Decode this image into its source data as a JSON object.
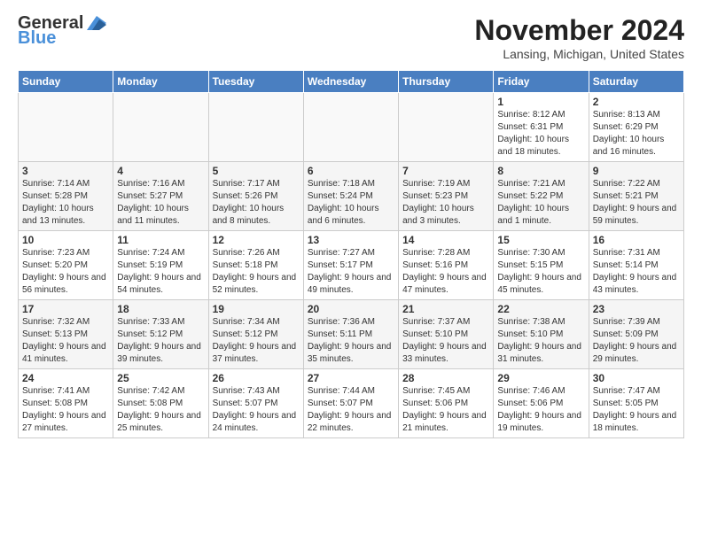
{
  "header": {
    "logo_general": "General",
    "logo_blue": "Blue",
    "month_title": "November 2024",
    "location": "Lansing, Michigan, United States"
  },
  "weekdays": [
    "Sunday",
    "Monday",
    "Tuesday",
    "Wednesday",
    "Thursday",
    "Friday",
    "Saturday"
  ],
  "weeks": [
    [
      {
        "day": "",
        "info": ""
      },
      {
        "day": "",
        "info": ""
      },
      {
        "day": "",
        "info": ""
      },
      {
        "day": "",
        "info": ""
      },
      {
        "day": "",
        "info": ""
      },
      {
        "day": "1",
        "info": "Sunrise: 8:12 AM\nSunset: 6:31 PM\nDaylight: 10 hours and 18 minutes."
      },
      {
        "day": "2",
        "info": "Sunrise: 8:13 AM\nSunset: 6:29 PM\nDaylight: 10 hours and 16 minutes."
      }
    ],
    [
      {
        "day": "3",
        "info": "Sunrise: 7:14 AM\nSunset: 5:28 PM\nDaylight: 10 hours and 13 minutes."
      },
      {
        "day": "4",
        "info": "Sunrise: 7:16 AM\nSunset: 5:27 PM\nDaylight: 10 hours and 11 minutes."
      },
      {
        "day": "5",
        "info": "Sunrise: 7:17 AM\nSunset: 5:26 PM\nDaylight: 10 hours and 8 minutes."
      },
      {
        "day": "6",
        "info": "Sunrise: 7:18 AM\nSunset: 5:24 PM\nDaylight: 10 hours and 6 minutes."
      },
      {
        "day": "7",
        "info": "Sunrise: 7:19 AM\nSunset: 5:23 PM\nDaylight: 10 hours and 3 minutes."
      },
      {
        "day": "8",
        "info": "Sunrise: 7:21 AM\nSunset: 5:22 PM\nDaylight: 10 hours and 1 minute."
      },
      {
        "day": "9",
        "info": "Sunrise: 7:22 AM\nSunset: 5:21 PM\nDaylight: 9 hours and 59 minutes."
      }
    ],
    [
      {
        "day": "10",
        "info": "Sunrise: 7:23 AM\nSunset: 5:20 PM\nDaylight: 9 hours and 56 minutes."
      },
      {
        "day": "11",
        "info": "Sunrise: 7:24 AM\nSunset: 5:19 PM\nDaylight: 9 hours and 54 minutes."
      },
      {
        "day": "12",
        "info": "Sunrise: 7:26 AM\nSunset: 5:18 PM\nDaylight: 9 hours and 52 minutes."
      },
      {
        "day": "13",
        "info": "Sunrise: 7:27 AM\nSunset: 5:17 PM\nDaylight: 9 hours and 49 minutes."
      },
      {
        "day": "14",
        "info": "Sunrise: 7:28 AM\nSunset: 5:16 PM\nDaylight: 9 hours and 47 minutes."
      },
      {
        "day": "15",
        "info": "Sunrise: 7:30 AM\nSunset: 5:15 PM\nDaylight: 9 hours and 45 minutes."
      },
      {
        "day": "16",
        "info": "Sunrise: 7:31 AM\nSunset: 5:14 PM\nDaylight: 9 hours and 43 minutes."
      }
    ],
    [
      {
        "day": "17",
        "info": "Sunrise: 7:32 AM\nSunset: 5:13 PM\nDaylight: 9 hours and 41 minutes."
      },
      {
        "day": "18",
        "info": "Sunrise: 7:33 AM\nSunset: 5:12 PM\nDaylight: 9 hours and 39 minutes."
      },
      {
        "day": "19",
        "info": "Sunrise: 7:34 AM\nSunset: 5:12 PM\nDaylight: 9 hours and 37 minutes."
      },
      {
        "day": "20",
        "info": "Sunrise: 7:36 AM\nSunset: 5:11 PM\nDaylight: 9 hours and 35 minutes."
      },
      {
        "day": "21",
        "info": "Sunrise: 7:37 AM\nSunset: 5:10 PM\nDaylight: 9 hours and 33 minutes."
      },
      {
        "day": "22",
        "info": "Sunrise: 7:38 AM\nSunset: 5:10 PM\nDaylight: 9 hours and 31 minutes."
      },
      {
        "day": "23",
        "info": "Sunrise: 7:39 AM\nSunset: 5:09 PM\nDaylight: 9 hours and 29 minutes."
      }
    ],
    [
      {
        "day": "24",
        "info": "Sunrise: 7:41 AM\nSunset: 5:08 PM\nDaylight: 9 hours and 27 minutes."
      },
      {
        "day": "25",
        "info": "Sunrise: 7:42 AM\nSunset: 5:08 PM\nDaylight: 9 hours and 25 minutes."
      },
      {
        "day": "26",
        "info": "Sunrise: 7:43 AM\nSunset: 5:07 PM\nDaylight: 9 hours and 24 minutes."
      },
      {
        "day": "27",
        "info": "Sunrise: 7:44 AM\nSunset: 5:07 PM\nDaylight: 9 hours and 22 minutes."
      },
      {
        "day": "28",
        "info": "Sunrise: 7:45 AM\nSunset: 5:06 PM\nDaylight: 9 hours and 21 minutes."
      },
      {
        "day": "29",
        "info": "Sunrise: 7:46 AM\nSunset: 5:06 PM\nDaylight: 9 hours and 19 minutes."
      },
      {
        "day": "30",
        "info": "Sunrise: 7:47 AM\nSunset: 5:05 PM\nDaylight: 9 hours and 18 minutes."
      }
    ]
  ]
}
